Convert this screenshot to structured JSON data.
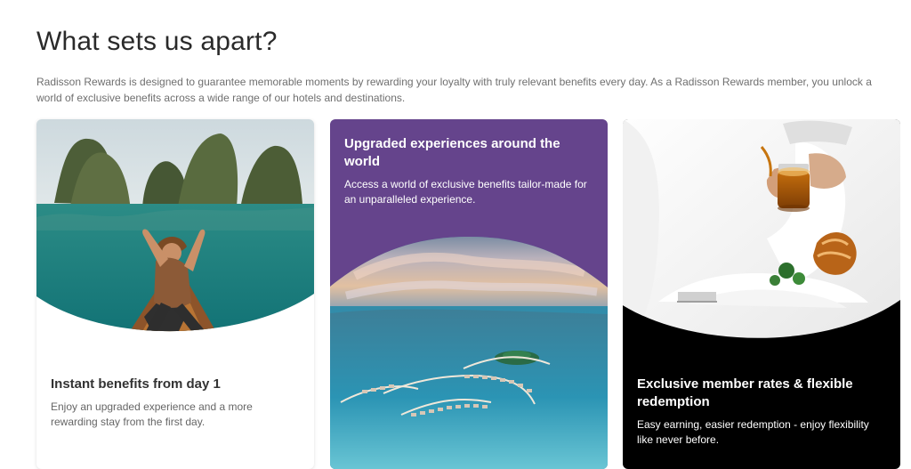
{
  "section": {
    "title": "What sets us apart?",
    "intro": "Radisson Rewards is designed to guarantee memorable moments by rewarding your loyalty with truly relevant benefits every day. As a Radisson Rewards member, you unlock a world of exclusive benefits across a wide range of our hotels and destinations."
  },
  "cards": [
    {
      "heading": "Instant benefits from day 1",
      "text": "Enjoy an upgraded experience and a more rewarding stay from the first day."
    },
    {
      "heading": "Upgraded experiences around the world",
      "text": "Access a world of exclusive benefits tailor-made for an unparalleled experience."
    },
    {
      "heading": "Exclusive member rates & flexible redemption",
      "text": "Easy earning, easier redemption - enjoy flexibility like never before."
    }
  ],
  "colors": {
    "purple_card": "#65448c",
    "black_card": "#000000",
    "text_dark": "#333333",
    "text_muted": "#666666"
  }
}
